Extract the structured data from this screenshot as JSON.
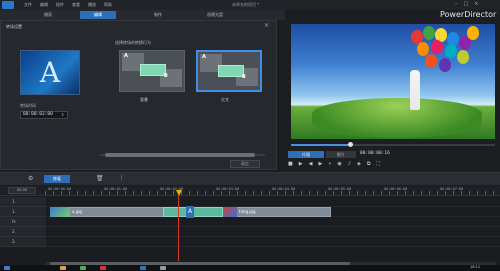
{
  "app": {
    "brand": "PowerDirector",
    "project_name": "未命名的项目 *",
    "menu": [
      "文件",
      "编辑",
      "插件",
      "查看",
      "播放",
      "帮助"
    ],
    "window_controls": [
      "minimize-icon",
      "maximize-icon",
      "close-icon"
    ]
  },
  "module_tabs": [
    {
      "label": "捕获"
    },
    {
      "label": "编辑"
    },
    {
      "label": "制作"
    },
    {
      "label": "创建光盘"
    }
  ],
  "designer": {
    "title": "转场设置",
    "thumbnail_letter": "A",
    "duration_label": "转场时间",
    "duration_value": "00:00:02:00",
    "choose_label": "选择转场的转换行为",
    "options": [
      {
        "label": "重叠",
        "a": "A",
        "b": "B"
      },
      {
        "label": "交叉",
        "a": "A",
        "b": "B"
      }
    ],
    "selected_option": "交叉",
    "ok_label": "确定"
  },
  "preview": {
    "clip_mode": "片段",
    "movie_mode": "影片",
    "timecode": "00:00:00:16",
    "seek_position": 0.29
  },
  "toolbar": {
    "fix_label": "修复"
  },
  "timeline": {
    "zoom_label": "00:00",
    "ticks": [
      "00:00:00:00",
      "00:00:01:00",
      "00:00:02:00",
      "00:00:03:00",
      "00:00:04:00",
      "00:00:05:00",
      "00:00:06:00",
      "00:00:07:00"
    ],
    "tracks": [
      "1.",
      "1.",
      "fx",
      "2.",
      "2."
    ],
    "clip_a_label": "a.jpg",
    "clip_b_label": "timg.jpg"
  },
  "taskbar": {
    "time": "16:11"
  },
  "colors": {
    "accent": "#2f6fb8",
    "transition_clip": "#5fb7a0",
    "playhead": "#d23b2b"
  }
}
